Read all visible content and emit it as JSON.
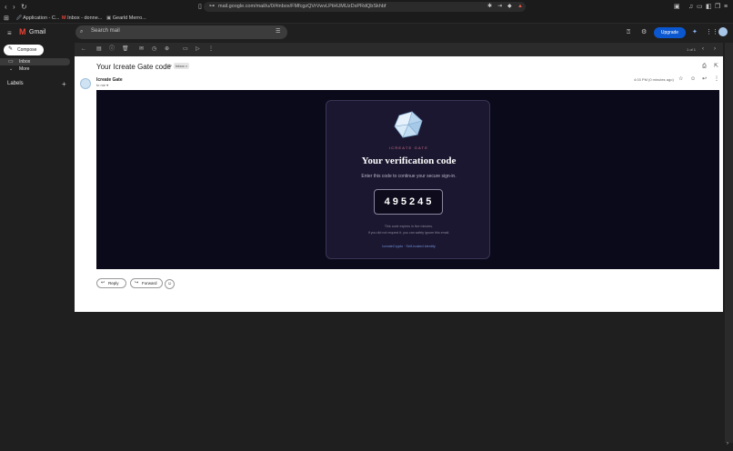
{
  "browser": {
    "url": "mail.google.com/mail/u/0/#inbox/FMfcgzQVrVwvLPtHUMUzDsPRdQbSkhbf",
    "bookmarks": [
      "Application - C...",
      "Inbox - donne...",
      "Gearld Merro..."
    ]
  },
  "gmail": {
    "logo_text": "Gmail",
    "search_placeholder": "Search mail",
    "upgrade_label": "Upgrade",
    "compose_label": "Compose",
    "sidebar": {
      "inbox": "Inbox",
      "more": "More",
      "labels": "Labels"
    },
    "pagination": "1 of 1"
  },
  "email": {
    "subject": "Your Icreate Gate code",
    "label_chip": "Inbox ×",
    "sender": "Icreate Gate",
    "to": "to me ▾",
    "time": "4:03 PM (0 minutes ago)",
    "reply_label": "Reply",
    "forward_label": "Forward"
  },
  "card": {
    "brand": "ICREATE GATE",
    "title": "Your verification code",
    "subtitle": "Enter this code to continue your secure sign-in.",
    "code": "495245",
    "expiry_line1": "This code expires in five minutes.",
    "expiry_line2": "If you did not request it, you can safely ignore this email.",
    "footer": "IcreateCrypto · Self-hosted identity"
  },
  "colors": {
    "accent_blue": "#0b57d0",
    "brand_pink": "#d8718a",
    "banner_bg": "#0b0a1a"
  }
}
